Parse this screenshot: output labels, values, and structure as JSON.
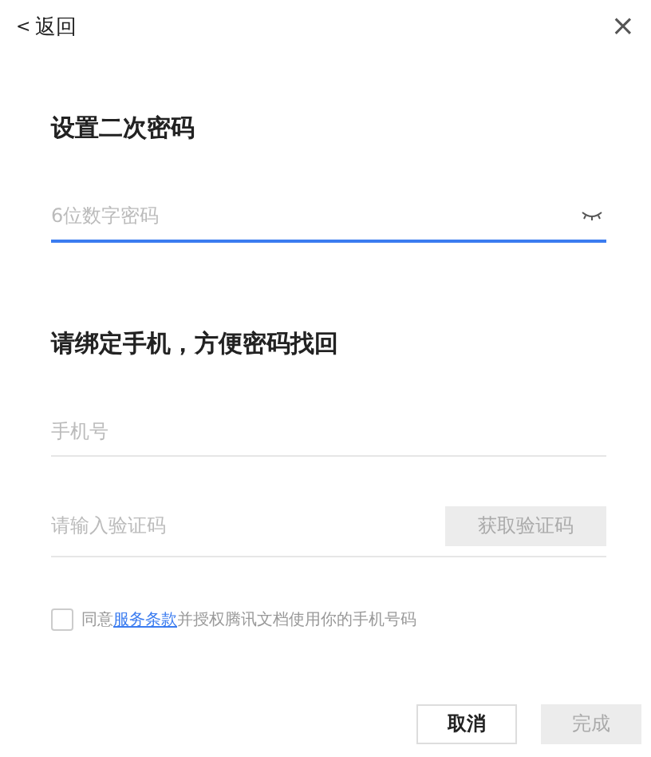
{
  "header": {
    "back_arrow": "<",
    "back_label": "返回",
    "close": "×"
  },
  "password_section": {
    "title": "设置二次密码",
    "field": {
      "placeholder": "6位数字密码",
      "focused": true
    }
  },
  "phone_section": {
    "title": "请绑定手机，方便密码找回",
    "phone_field": {
      "placeholder": "手机号",
      "focused": false
    },
    "code_field": {
      "placeholder": "请输入验证码",
      "focused": false
    },
    "get_code_button": {
      "label": "获取验证码",
      "disabled": true
    }
  },
  "agreement": {
    "checked": false,
    "prefix": "同意",
    "link": "服务条款",
    "suffix": "并授权腾讯文档使用你的手机号码"
  },
  "buttons": [
    {
      "label": "取消",
      "disabled": false
    },
    {
      "label": "完成",
      "disabled": true
    }
  ]
}
